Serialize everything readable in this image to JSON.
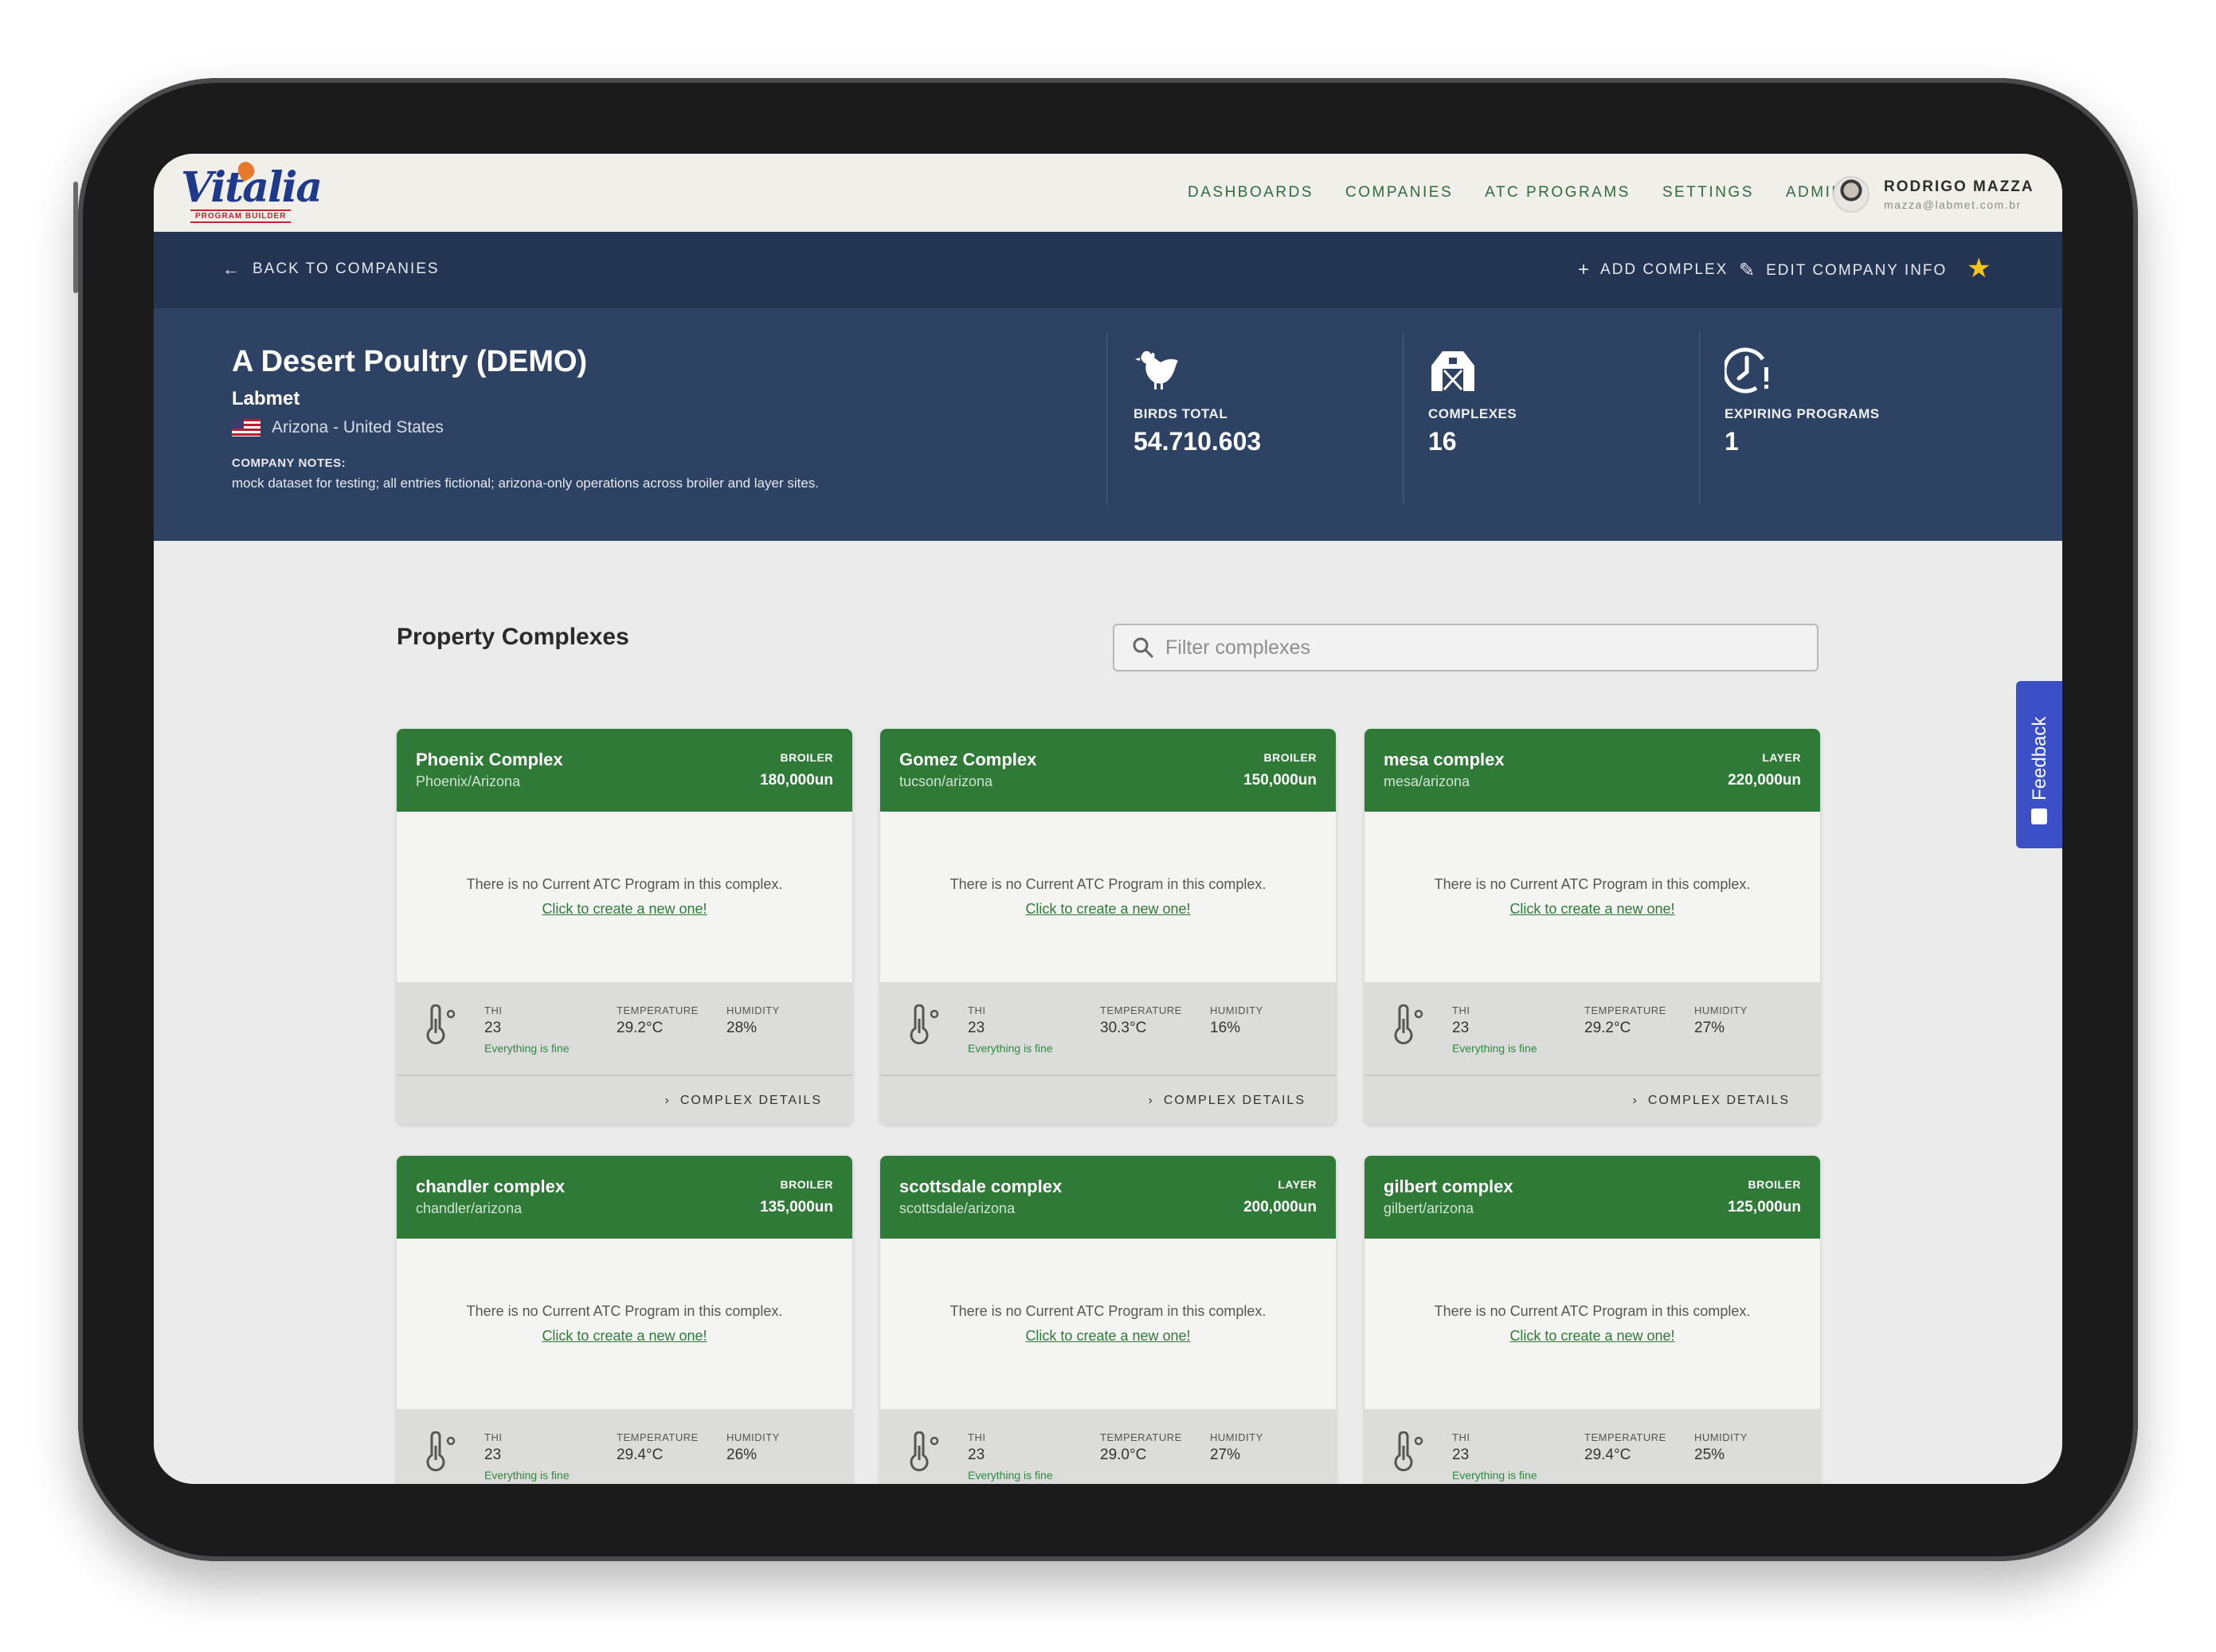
{
  "nav": {
    "logo": "Vitalia",
    "logo_sub": "PROGRAM BUILDER",
    "links": [
      "DASHBOARDS",
      "COMPANIES",
      "ATC PROGRAMS",
      "SETTINGS",
      "ADMIN"
    ],
    "user_name": "RODRIGO MAZZA",
    "user_email": "mazza@labmet.com.br"
  },
  "actions": {
    "back": "BACK TO COMPANIES",
    "add_complex": "ADD COMPLEX",
    "edit_company": "EDIT COMPANY INFO"
  },
  "company": {
    "name": "A Desert Poultry (DEMO)",
    "owner": "Labmet",
    "location": "Arizona - United States",
    "notes_label": "COMPANY NOTES:",
    "notes": "mock dataset for testing; all entries fictional; arizona-only operations across broiler and layer sites.",
    "stats": [
      {
        "label": "BIRDS TOTAL",
        "value": "54.710.603",
        "icon": "chicken-icon"
      },
      {
        "label": "COMPLEXES",
        "value": "16",
        "icon": "barn-icon"
      },
      {
        "label": "EXPIRING PROGRAMS",
        "value": "1",
        "icon": "clock-alert-icon"
      }
    ]
  },
  "content": {
    "title": "Property Complexes",
    "filter_placeholder": "Filter complexes"
  },
  "card_labels": {
    "no_program": "There is no Current ATC Program in this complex.",
    "create": "Click to create a new one!",
    "thi": "THI",
    "temperature": "TEMPERATURE",
    "humidity": "HUMIDITY",
    "details": "COMPLEX DETAILS"
  },
  "complexes": [
    {
      "name": "Phoenix Complex",
      "location": "Phoenix/Arizona",
      "type": "BROILER",
      "count": "180,000un",
      "thi": "23",
      "status": "Everything is fine",
      "temperature": "29.2°C",
      "humidity": "28%"
    },
    {
      "name": "Gomez Complex",
      "location": "tucson/arizona",
      "type": "BROILER",
      "count": "150,000un",
      "thi": "23",
      "status": "Everything is fine",
      "temperature": "30.3°C",
      "humidity": "16%"
    },
    {
      "name": "mesa complex",
      "location": "mesa/arizona",
      "type": "LAYER",
      "count": "220,000un",
      "thi": "23",
      "status": "Everything is fine",
      "temperature": "29.2°C",
      "humidity": "27%"
    },
    {
      "name": "chandler complex",
      "location": "chandler/arizona",
      "type": "BROILER",
      "count": "135,000un",
      "thi": "23",
      "status": "Everything is fine",
      "temperature": "29.4°C",
      "humidity": "26%"
    },
    {
      "name": "scottsdale complex",
      "location": "scottsdale/arizona",
      "type": "LAYER",
      "count": "200,000un",
      "thi": "23",
      "status": "Everything is fine",
      "temperature": "29.0°C",
      "humidity": "27%"
    },
    {
      "name": "gilbert complex",
      "location": "gilbert/arizona",
      "type": "BROILER",
      "count": "125,000un",
      "thi": "23",
      "status": "Everything is fine",
      "temperature": "29.4°C",
      "humidity": "25%"
    }
  ],
  "feedback": "Feedback",
  "colors": {
    "nav_bg": "#f0efe9",
    "action_bar": "#243553",
    "header_bg": "#2e4264",
    "card_header": "#2f7a37",
    "status_ok": "#2f8a3f",
    "feedback_tab": "#3b4fc7",
    "star": "#f5c518"
  }
}
